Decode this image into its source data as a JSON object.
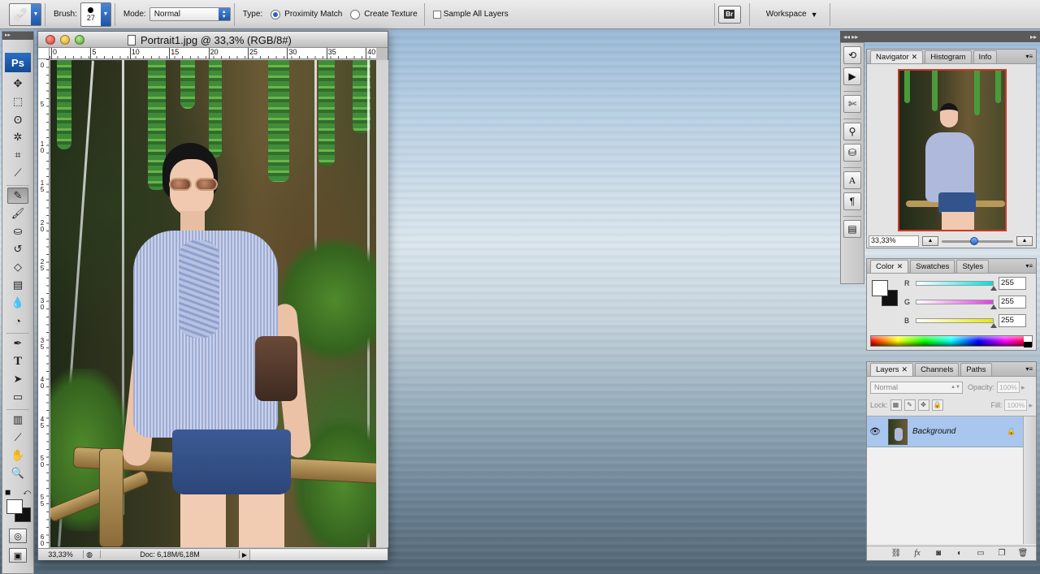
{
  "options_bar": {
    "brush_label": "Brush:",
    "brush_size": "27",
    "mode_label": "Mode:",
    "mode_value": "Normal",
    "type_label": "Type:",
    "type_options": [
      "Proximity Match",
      "Create Texture"
    ],
    "sample_all_layers": "Sample All Layers",
    "bridge_label": "Br",
    "workspace_label": "Workspace"
  },
  "toolbox": {
    "logo": "Ps"
  },
  "document": {
    "title": "Portrait1.jpg @ 33,3% (RGB/8#)",
    "ruler_h_labels": [
      "0",
      "5",
      "10",
      "15",
      "20",
      "25",
      "30",
      "35",
      "40"
    ],
    "ruler_v_labels": [
      "0",
      "5",
      "10",
      "15",
      "20",
      "25",
      "30",
      "35",
      "40",
      "45",
      "50",
      "55",
      "60"
    ],
    "zoom": "33,33%",
    "doc_info": "Doc: 6,18M/6,18M"
  },
  "navigator": {
    "tabs": [
      "Navigator",
      "Histogram",
      "Info"
    ],
    "zoom": "33,33%",
    "slider_fraction": 0.4
  },
  "color_panel": {
    "tabs": [
      "Color",
      "Swatches",
      "Styles"
    ],
    "channels": [
      {
        "label": "R",
        "value": "255",
        "color": "#00e0e0"
      },
      {
        "label": "G",
        "value": "255",
        "color": "#e040e0"
      },
      {
        "label": "B",
        "value": "255",
        "color": "#e8e800"
      }
    ],
    "foreground": "#ffffff",
    "background": "#111111"
  },
  "layers_panel": {
    "tabs": [
      "Layers",
      "Channels",
      "Paths"
    ],
    "blend_mode": "Normal",
    "opacity_label": "Opacity:",
    "opacity_value": "100%",
    "lock_label": "Lock:",
    "fill_label": "Fill:",
    "fill_value": "100%",
    "layers": [
      {
        "name": "Background",
        "visible": true,
        "locked": true
      }
    ]
  }
}
